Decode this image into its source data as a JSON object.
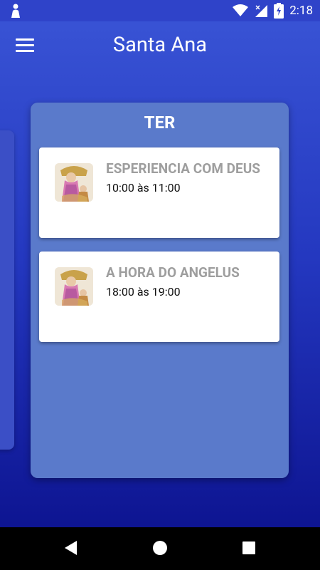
{
  "status_bar": {
    "time": "2:18",
    "icons": [
      "notification-icon",
      "wifi-icon",
      "signal-icon",
      "battery-charging-icon"
    ]
  },
  "app_bar": {
    "title": "Santa Ana",
    "menu_icon": "hamburger-menu-icon"
  },
  "schedule": {
    "day": "TER",
    "events": [
      {
        "title": "ESPERIENCIA COM DEUS",
        "time": "10:00 às 11:00",
        "thumbnail": "saint-image"
      },
      {
        "title": "A HORA DO ANGELUS",
        "time": "18:00 às 19:00",
        "thumbnail": "saint-image"
      }
    ]
  },
  "nav_bar": {
    "buttons": [
      "back-icon",
      "home-icon",
      "recents-icon"
    ]
  },
  "colors": {
    "accent": "#2f43c9",
    "card": "#5a7acb",
    "event_title": "#9e9e9e"
  }
}
